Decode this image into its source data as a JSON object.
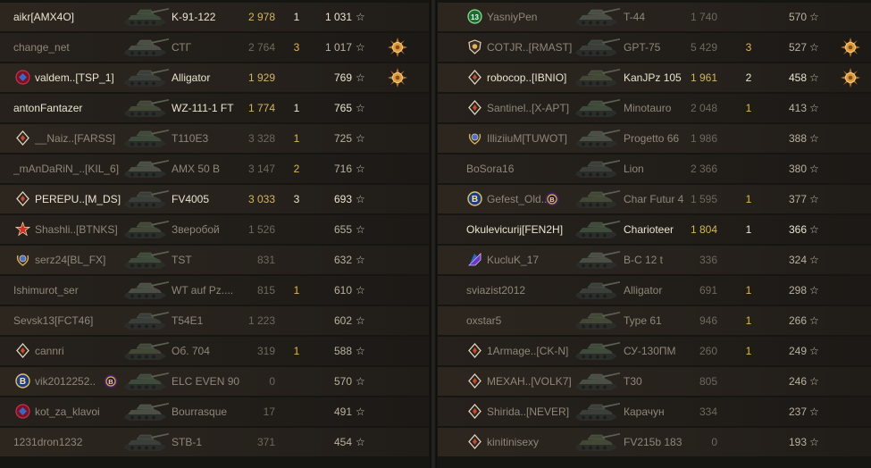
{
  "colors": {
    "row_bg": "#26211c",
    "player_alive": "#eae4d0",
    "player_dead": "#8e877a",
    "damage_top": "#d6b55f",
    "damage_normal": "#6e685d",
    "frags": "#e1b84e"
  },
  "teams": [
    {
      "rows": [
        {
          "player": "aikr[AMX4O]",
          "badge": null,
          "tank": "K-91-122",
          "damage": "2 978",
          "frags": "1",
          "xp": "1 031",
          "status": "alive",
          "top": true,
          "medal": null,
          "extra": null
        },
        {
          "player": "change_net",
          "badge": null,
          "tank": "СТГ",
          "damage": "2 764",
          "frags": "3",
          "xp": "1 017",
          "status": "dead",
          "top": false,
          "medal": "bronze-medal-icon",
          "extra": null
        },
        {
          "player": "valdem..[TSP_1]",
          "badge": "red-rank-icon",
          "tank": "Alligator",
          "damage": "1 929",
          "frags": "",
          "xp": "769",
          "status": "alive",
          "top": true,
          "medal": "bronze-medal-icon",
          "extra": null
        },
        {
          "player": "antonFantazer",
          "badge": null,
          "tank": "WZ-111-1 FT",
          "damage": "1 774",
          "frags": "1",
          "xp": "765",
          "status": "alive",
          "top": true,
          "medal": null,
          "extra": null
        },
        {
          "player": "__Naiz..[FARSS]",
          "badge": "diamond-rank-icon",
          "tank": "T110E3",
          "damage": "3 328",
          "frags": "1",
          "xp": "725",
          "status": "dead",
          "top": false,
          "medal": null,
          "extra": null
        },
        {
          "player": "_mAnDaRiN_..[KIL_6]",
          "badge": null,
          "tank": "AMX 50 B",
          "damage": "3 147",
          "frags": "2",
          "xp": "716",
          "status": "dead",
          "top": false,
          "medal": null,
          "extra": null
        },
        {
          "player": "PEREPU..[M_DS]",
          "badge": "diamond-rank-icon",
          "tank": "FV4005",
          "damage": "3 033",
          "frags": "3",
          "xp": "693",
          "status": "alive",
          "top": true,
          "medal": null,
          "extra": null
        },
        {
          "player": "Shashli..[BTNKS]",
          "badge": "red-star-icon",
          "tank": "Зверобой",
          "damage": "1 526",
          "frags": "",
          "xp": "655",
          "status": "dead",
          "top": false,
          "medal": null,
          "extra": null
        },
        {
          "player": "serz24[BL_FX]",
          "badge": "laurel-rank-icon",
          "tank": "TST",
          "damage": "831",
          "frags": "",
          "xp": "632",
          "status": "dead",
          "top": false,
          "medal": null,
          "extra": null
        },
        {
          "player": "Ishimurot_ser",
          "badge": null,
          "tank": "WT auf Pz....",
          "damage": "815",
          "frags": "1",
          "xp": "610",
          "status": "dead",
          "top": false,
          "medal": null,
          "extra": null
        },
        {
          "player": "Sevsk13[FCT46]",
          "badge": null,
          "tank": "T54E1",
          "damage": "1 223",
          "frags": "",
          "xp": "602",
          "status": "dead",
          "top": false,
          "medal": null,
          "extra": null
        },
        {
          "player": "cannri",
          "badge": "diamond-rank-icon",
          "tank": "Об. 704",
          "damage": "319",
          "frags": "1",
          "xp": "588",
          "status": "dead",
          "top": false,
          "medal": null,
          "extra": null
        },
        {
          "player": "vik2012252..",
          "badge": "b-coin-icon",
          "tank": "ELC EVEN 90",
          "damage": "0",
          "frags": "",
          "xp": "570",
          "status": "dead",
          "top": false,
          "medal": null,
          "extra": "b-coin-purple-icon"
        },
        {
          "player": "kot_za_klavoi",
          "badge": "red-rank-icon",
          "tank": "Bourrasque",
          "damage": "17",
          "frags": "",
          "xp": "491",
          "status": "dead",
          "top": false,
          "medal": null,
          "extra": null
        },
        {
          "player": "1231dron1232",
          "badge": null,
          "tank": "STB-1",
          "damage": "371",
          "frags": "",
          "xp": "454",
          "status": "dead",
          "top": false,
          "medal": null,
          "extra": null
        }
      ]
    },
    {
      "rows": [
        {
          "player": "YasniyPen",
          "badge": "green-13-icon",
          "tank": "T-44",
          "damage": "1 740",
          "frags": "",
          "xp": "570",
          "status": "dead",
          "top": false,
          "medal": null,
          "extra": null
        },
        {
          "player": "COTJR..[RMAST]",
          "badge": "shield-rank-icon",
          "tank": "GPT-75",
          "damage": "5 429",
          "frags": "3",
          "xp": "527",
          "status": "dead",
          "top": false,
          "medal": "bronze-medal-icon",
          "extra": null
        },
        {
          "player": "robocop..[IBNIO]",
          "badge": "diamond-rank-icon",
          "tank": "KanJPz 105",
          "damage": "1 961",
          "frags": "2",
          "xp": "458",
          "status": "alive",
          "top": true,
          "medal": "bronze-medal-icon",
          "extra": null
        },
        {
          "player": "Santinel..[X-APT]",
          "badge": "diamond-rank-icon",
          "tank": "Minotauro",
          "damage": "2 048",
          "frags": "1",
          "xp": "413",
          "status": "dead",
          "top": false,
          "medal": null,
          "extra": null
        },
        {
          "player": "IlliziiuM[TUWOT]",
          "badge": "laurel-rank-icon",
          "tank": "Progetto 66",
          "damage": "1 986",
          "frags": "",
          "xp": "388",
          "status": "dead",
          "top": false,
          "medal": null,
          "extra": null
        },
        {
          "player": "BoSora16",
          "badge": null,
          "tank": "Lion",
          "damage": "2 366",
          "frags": "",
          "xp": "380",
          "status": "dead",
          "top": false,
          "medal": null,
          "extra": null
        },
        {
          "player": "Gefest_Old..",
          "badge": "b-coin-icon",
          "tank": "Char Futur 4",
          "damage": "1 595",
          "frags": "1",
          "xp": "377",
          "status": "dead",
          "top": false,
          "medal": null,
          "extra": "b-coin-purple-icon"
        },
        {
          "player": "Okulevicurij[FEN2H]",
          "badge": null,
          "tank": "Charioteer",
          "damage": "1 804",
          "frags": "1",
          "xp": "366",
          "status": "alive",
          "top": true,
          "medal": null,
          "extra": null
        },
        {
          "player": "KucluK_17",
          "badge": "purple-rank-icon",
          "tank": "B-C 12 t",
          "damage": "336",
          "frags": "",
          "xp": "324",
          "status": "dead",
          "top": false,
          "medal": null,
          "extra": null
        },
        {
          "player": "sviazist2012",
          "badge": null,
          "tank": "Alligator",
          "damage": "691",
          "frags": "1",
          "xp": "298",
          "status": "dead",
          "top": false,
          "medal": null,
          "extra": null
        },
        {
          "player": "oxstar5",
          "badge": null,
          "tank": "Type 61",
          "damage": "946",
          "frags": "1",
          "xp": "266",
          "status": "dead",
          "top": false,
          "medal": null,
          "extra": null
        },
        {
          "player": "1Armage..[CK-N]",
          "badge": "diamond-rank-icon",
          "tank": "СУ-130ПМ",
          "damage": "260",
          "frags": "1",
          "xp": "249",
          "status": "dead",
          "top": false,
          "medal": null,
          "extra": null
        },
        {
          "player": "MEXAH..[VOLK7]",
          "badge": "diamond-rank-icon",
          "tank": "T30",
          "damage": "805",
          "frags": "",
          "xp": "246",
          "status": "dead",
          "top": false,
          "medal": null,
          "extra": null
        },
        {
          "player": "Shirida..[NEVER]",
          "badge": "diamond-rank-icon",
          "tank": "Карачун",
          "damage": "334",
          "frags": "",
          "xp": "237",
          "status": "dead",
          "top": false,
          "medal": null,
          "extra": null
        },
        {
          "player": "kinitinisexy",
          "badge": "diamond-rank-icon",
          "tank": "FV215b 183",
          "damage": "0",
          "frags": "",
          "xp": "193",
          "status": "dead",
          "top": false,
          "medal": null,
          "extra": null
        }
      ]
    }
  ]
}
